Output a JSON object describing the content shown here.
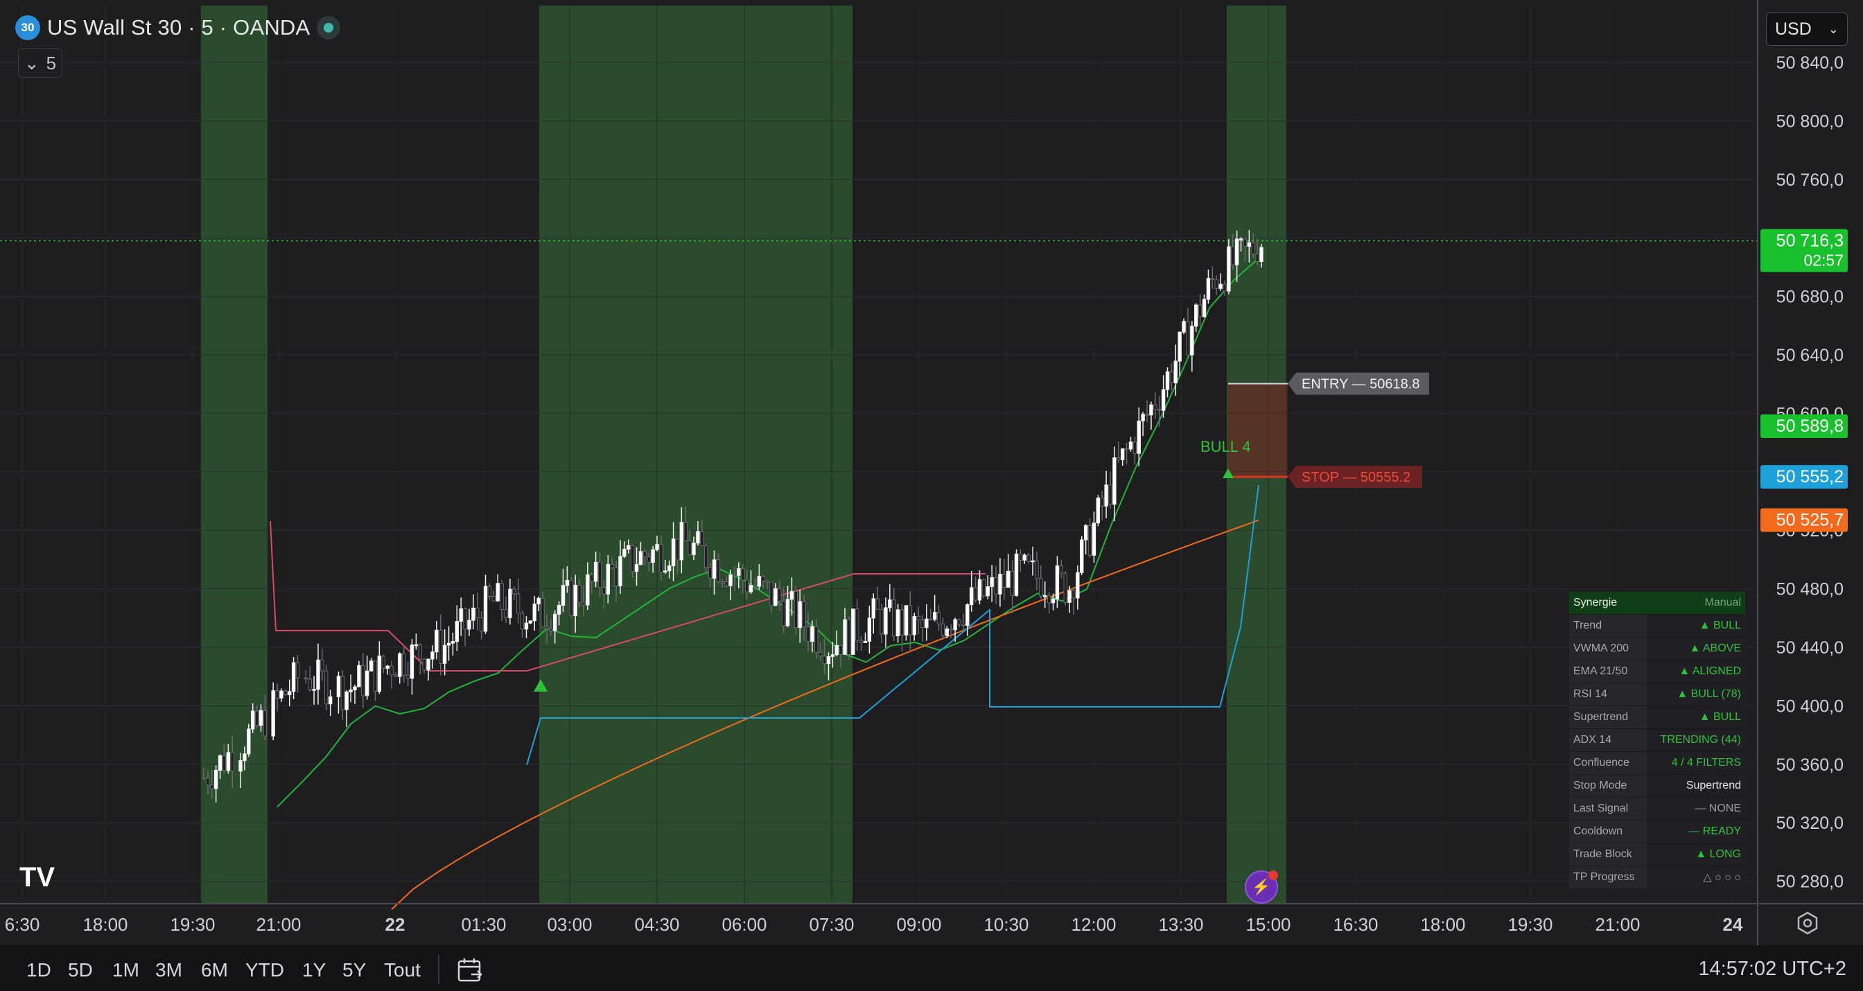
{
  "header": {
    "badge": "30",
    "symbol": "US Wall St 30 · 5 · OANDA",
    "indicator_count": "5"
  },
  "currency": {
    "selected": "USD"
  },
  "price_axis": {
    "labels": [
      "50 840,0",
      "50 800,0",
      "50 760,0",
      "50 720,0",
      "50 680,0",
      "50 640,0",
      "50 600,0",
      "50 560,0",
      "50 520,0",
      "50 480,0",
      "50 440,0",
      "50 400,0",
      "50 360,0",
      "50 320,0",
      "50 280,0"
    ],
    "tags": [
      {
        "value": "50 716,3",
        "sub": "02:57",
        "color": "#18c12c"
      },
      {
        "value": "50 589,8",
        "color": "#18c12c"
      },
      {
        "value": "50 555,2",
        "color": "#1da1d8"
      },
      {
        "value": "50 525,7",
        "color": "#f26b1d"
      }
    ]
  },
  "time_axis": {
    "labels": [
      "6:30",
      "18:00",
      "19:30",
      "21:00",
      "22",
      "01:30",
      "03:00",
      "04:30",
      "06:00",
      "07:30",
      "09:00",
      "10:30",
      "12:00",
      "13:30",
      "15:00",
      "16:30",
      "18:00",
      "19:30",
      "21:00",
      "24"
    ]
  },
  "chart_data": {
    "type": "candlestick",
    "symbol": "US Wall St 30",
    "timeframe": "5",
    "ylim": [
      50260,
      50860
    ],
    "last_price": 50716.3,
    "countdown": "02:57",
    "close_approx_series": [
      50350,
      50380,
      50420,
      50410,
      50430,
      50440,
      50470,
      50460,
      50480,
      50500,
      50510,
      50490,
      50470,
      50440,
      50460,
      50450,
      50470,
      50490,
      50480,
      50560,
      50620,
      50690,
      50716.3
    ],
    "overlays": {
      "ema_21": 50589.8,
      "supertrend": 50555.2,
      "ema_50": 50525.7
    },
    "annotations": [
      {
        "label": "ENTRY — 50618.8",
        "price": 50618.8
      },
      {
        "label": "STOP — 50555.2",
        "price": 50555.2
      },
      {
        "label": "BULL 4"
      }
    ]
  },
  "signal_table": {
    "title": "Synergie",
    "mode": "Manual",
    "rows": [
      {
        "key": "Trend",
        "value": "▲ BULL",
        "color": "#2ec23a"
      },
      {
        "key": "VWMA 200",
        "value": "▲ ABOVE",
        "color": "#2ec23a"
      },
      {
        "key": "EMA 21/50",
        "value": "▲ ALIGNED",
        "color": "#2ec23a"
      },
      {
        "key": "RSI 14",
        "value": "▲ BULL (78)",
        "color": "#2ec23a"
      },
      {
        "key": "Supertrend",
        "value": "▲ BULL",
        "color": "#2ec23a"
      },
      {
        "key": "ADX 14",
        "value": "TRENDING (44)",
        "color": "#2ec23a"
      },
      {
        "key": "Confluence",
        "value": "4 / 4 FILTERS",
        "color": "#2ec23a"
      },
      {
        "key": "Stop Mode",
        "value": "Supertrend",
        "color": "#e6e6e6"
      },
      {
        "key": "Last Signal",
        "value": "— NONE",
        "color": "#9a9aa0"
      },
      {
        "key": "Cooldown",
        "value": "— READY",
        "color": "#2ec23a"
      },
      {
        "key": "Trade Block",
        "value": "▲ LONG",
        "color": "#2ec23a"
      },
      {
        "key": "TP Progress",
        "value": "△ ○ ○ ○",
        "color": "#9a9aa0"
      }
    ]
  },
  "periods": [
    "1D",
    "5D",
    "1M",
    "3M",
    "6M",
    "YTD",
    "1Y",
    "5Y",
    "Tout"
  ],
  "clock": "14:57:02 UTC+2",
  "logo": "TV"
}
